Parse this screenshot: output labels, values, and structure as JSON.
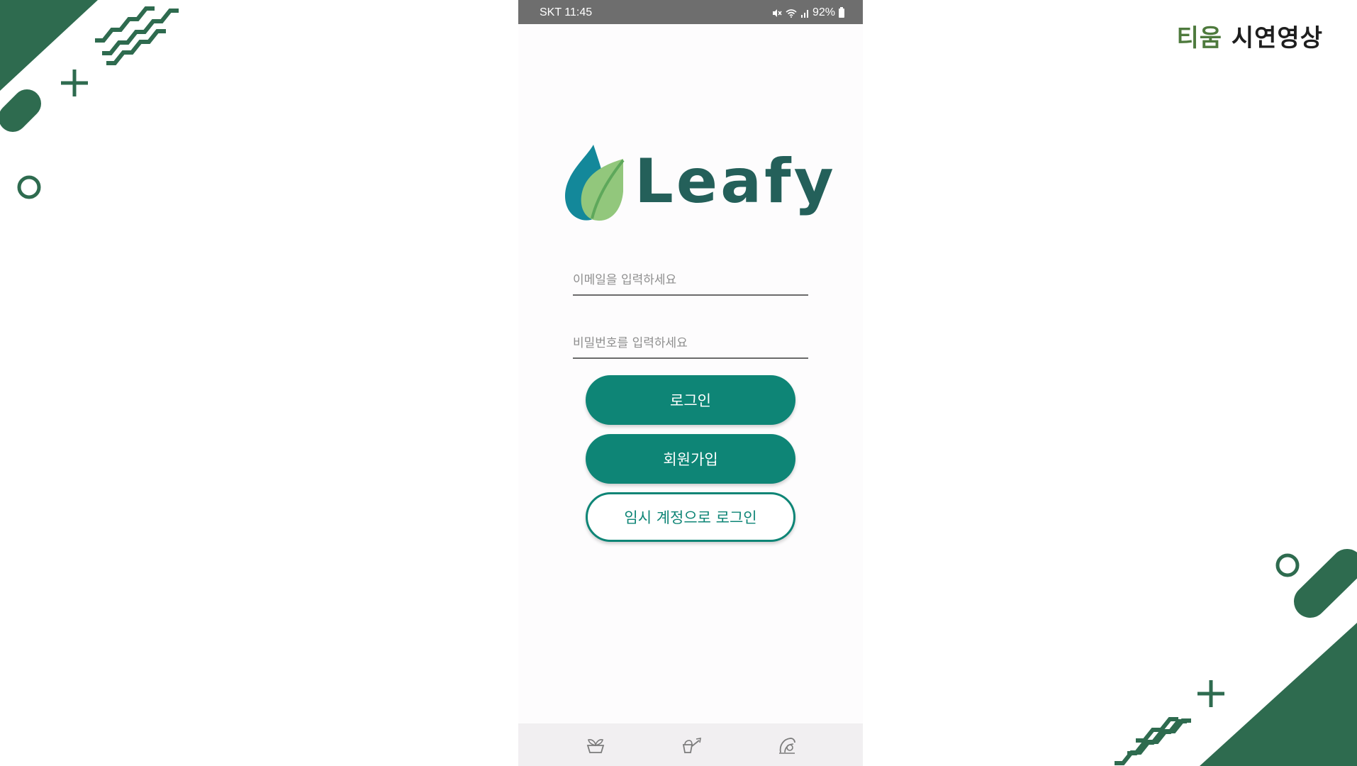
{
  "brand": {
    "team": "티움",
    "subtitle": "시연영상"
  },
  "colors": {
    "accent": "#0e8576",
    "decoration": "#2e6b4f",
    "logo_text": "#24605a",
    "team_text": "#4e7a3d",
    "status_bar": "#6e6e6e"
  },
  "status_bar": {
    "carrier_time": "SKT 11:45",
    "battery": "92%",
    "icons": [
      "mute-icon",
      "wifi-icon",
      "signal-icon",
      "battery-icon"
    ]
  },
  "app": {
    "logo_text": "Leafy",
    "logo_icon": "leaf-drop-icon",
    "email_placeholder": "이메일을 입력하세요",
    "password_placeholder": "비밀번호를 입력하세요",
    "login_label": "로그인",
    "signup_label": "회원가입",
    "guest_login_label": "임시 계정으로 로그인"
  },
  "bottom_nav": {
    "items": [
      "plant-pot-icon",
      "watering-icon",
      "profile-leaf-icon"
    ]
  }
}
